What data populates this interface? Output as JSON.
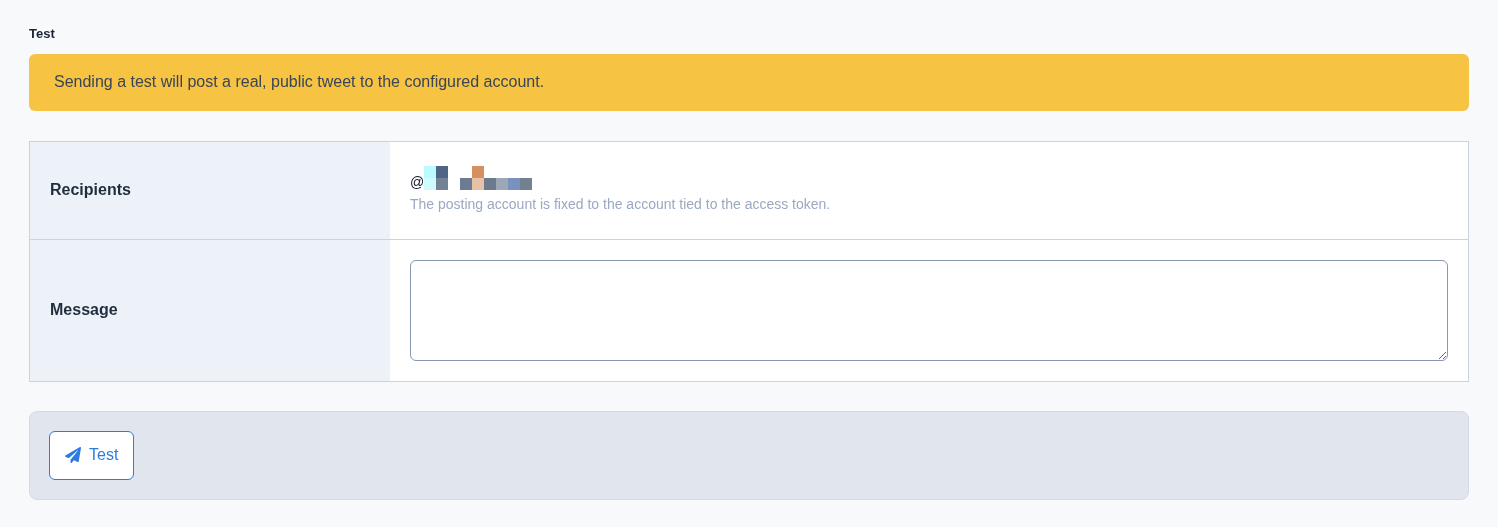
{
  "heading": "Test",
  "alert": {
    "text": "Sending a test will post a real, public tweet to the configured account."
  },
  "rows": [
    {
      "kind": "account",
      "label": "Recipients",
      "value": "@",
      "help": "The posting account is fixed to the account tied to the access token."
    },
    {
      "kind": "textarea",
      "label": "Message"
    }
  ],
  "button": {
    "label": "Test"
  }
}
